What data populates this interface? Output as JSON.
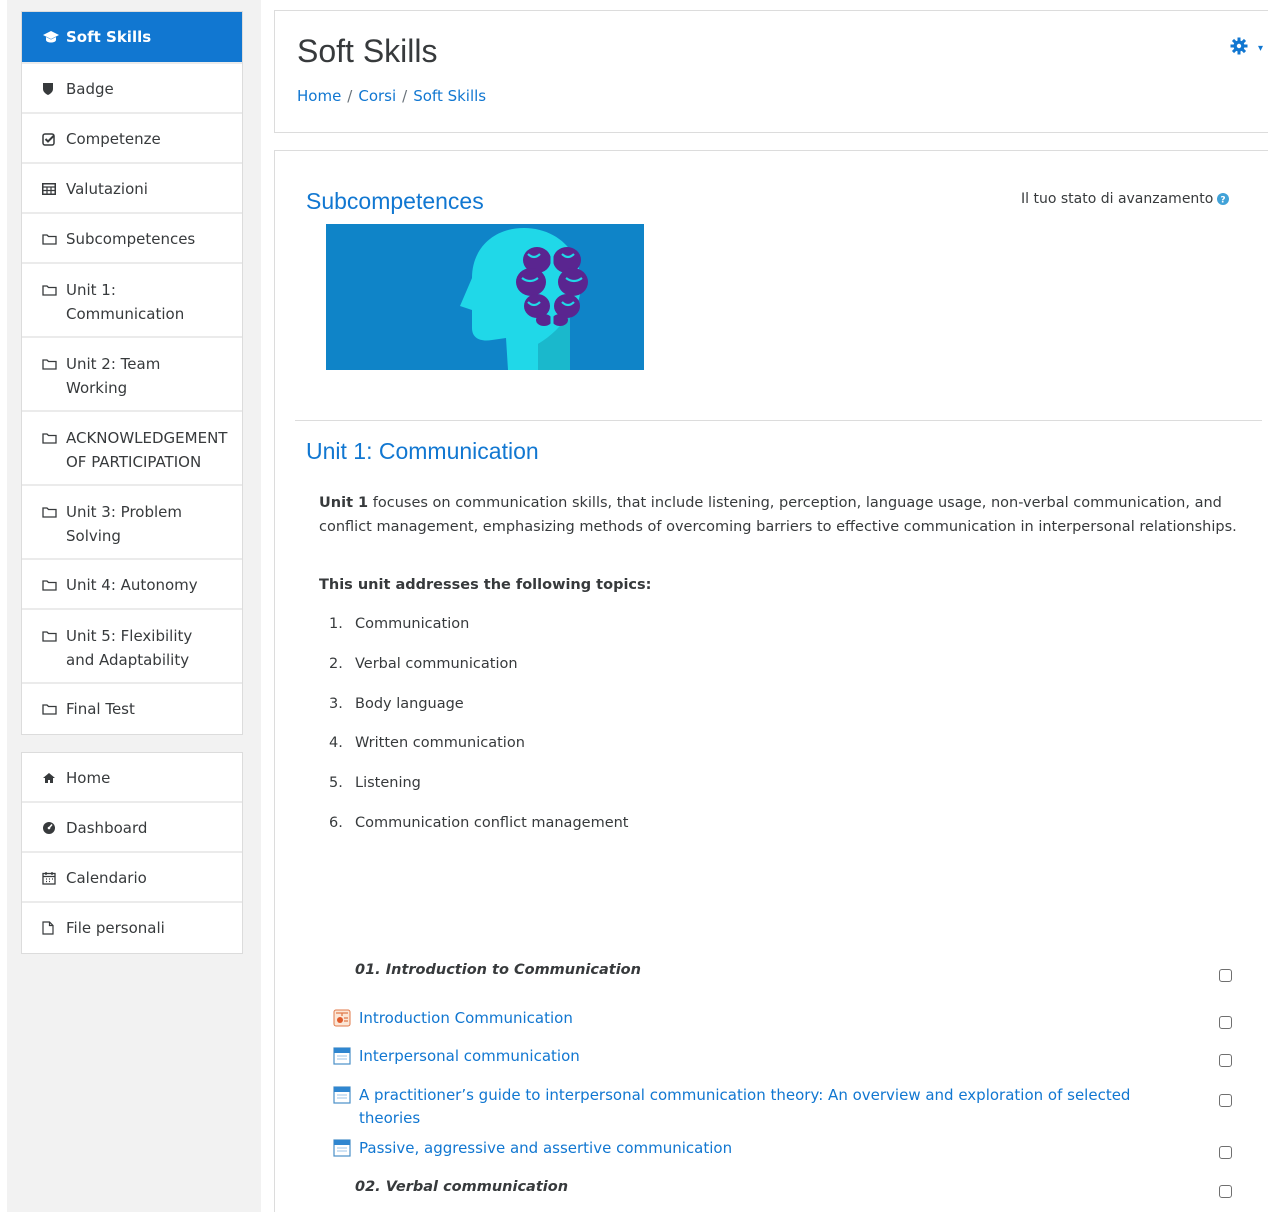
{
  "sidebar": {
    "course_items": [
      {
        "label": "Soft Skills",
        "icon": "graduation-cap-icon",
        "active": true
      },
      {
        "label": "Badge",
        "icon": "shield-icon"
      },
      {
        "label": "Competenze",
        "icon": "check-square-icon"
      },
      {
        "label": "Valutazioni",
        "icon": "table-icon"
      },
      {
        "label": "Subcompetences",
        "icon": "folder-icon"
      },
      {
        "label": "Unit 1: Communication",
        "icon": "folder-icon"
      },
      {
        "label": "Unit 2: Team Working",
        "icon": "folder-icon"
      },
      {
        "label": "ACKNOWLEDGEMENT OF PARTICIPATION",
        "icon": "folder-icon"
      },
      {
        "label": "Unit 3: Problem Solving",
        "icon": "folder-icon"
      },
      {
        "label": "Unit 4: Autonomy",
        "icon": "folder-icon"
      },
      {
        "label": "Unit 5: Flexibility and Adaptability",
        "icon": "folder-icon"
      },
      {
        "label": "Final Test",
        "icon": "folder-icon"
      }
    ],
    "site_items": [
      {
        "label": "Home",
        "icon": "home-icon"
      },
      {
        "label": "Dashboard",
        "icon": "dashboard-icon"
      },
      {
        "label": "Calendario",
        "icon": "calendar-icon"
      },
      {
        "label": "File personali",
        "icon": "file-icon"
      }
    ]
  },
  "header": {
    "title": "Soft Skills",
    "breadcrumb": [
      "Home",
      "Corsi",
      "Soft Skills"
    ],
    "gear_icon": "gear-icon"
  },
  "main": {
    "subcompetences_title": "Subcompetences",
    "progress_label": "Il tuo stato di avanzamento",
    "unit_title": "Unit 1: Communication",
    "summary_bold": "Unit 1",
    "summary_text": " focuses on communication skills, that include listening, perception, language usage, non-verbal communication, and conflict management, emphasizing methods of overcoming barriers to effective communication in interpersonal relationships.",
    "topics_heading": "This unit addresses the following topics:",
    "topics": [
      {
        "num": "1.",
        "text": "Communication"
      },
      {
        "num": "2.",
        "text": "Verbal communication"
      },
      {
        "num": "3.",
        "text": "Body language"
      },
      {
        "num": "4.",
        "text": "Written communication"
      },
      {
        "num": "5.",
        "text": "Listening"
      },
      {
        "num": "6.",
        "text": "Communication conflict management"
      }
    ],
    "subheading_1": "01. Introduction to Communication",
    "activities": [
      {
        "label": "Introduction Communication",
        "icon": "presentation-icon"
      },
      {
        "label": "Interpersonal communication",
        "icon": "page-icon"
      },
      {
        "label": "A practitioner’s guide to interpersonal communication theory: An overview and exploration of selected theories",
        "icon": "page-icon"
      },
      {
        "label": "Passive, aggressive and assertive communication",
        "icon": "page-icon"
      }
    ],
    "subheading_2": "02. Verbal communication"
  },
  "colors": {
    "accent": "#1177d1",
    "banner_bg": "#0f84c8",
    "head_color": "#20d8e8",
    "brain_color": "#5a2590"
  }
}
